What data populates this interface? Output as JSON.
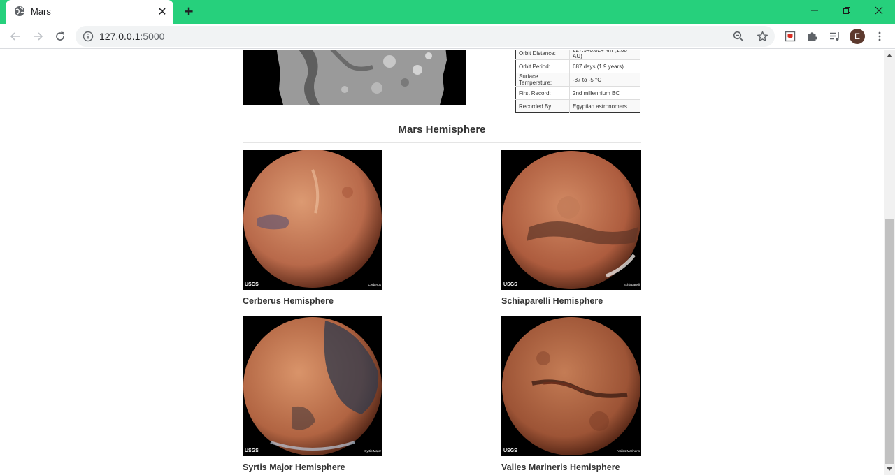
{
  "browser": {
    "tab_title": "Mars",
    "url_host": "127.0.0.1",
    "url_port": ":5000",
    "profile_initial": "E"
  },
  "facts": [
    {
      "label": "Orbit Distance:",
      "value": "227,943,824 km (1.38 AU)"
    },
    {
      "label": "Orbit Period:",
      "value": "687 days (1.9 years)"
    },
    {
      "label": "Surface Temperature:",
      "value": "-87 to -5 °C"
    },
    {
      "label": "First Record:",
      "value": "2nd millennium BC"
    },
    {
      "label": "Recorded By:",
      "value": "Egyptian astronomers"
    }
  ],
  "hemispheres_section": {
    "title": "Mars Hemisphere",
    "items": [
      {
        "name": "Cerberus Hemisphere",
        "caption": "Cerberus"
      },
      {
        "name": "Schiaparelli Hemisphere",
        "caption": "Schiaparelli"
      },
      {
        "name": "Syrtis Major Hemisphere",
        "caption": "Syrtis Major"
      },
      {
        "name": "Valles Marineris Hemisphere",
        "caption": "Valles Marineris"
      }
    ],
    "image_logo": "USGS"
  },
  "colors": {
    "tabstrip": "#26d07c",
    "mars_light": "#d98a5f",
    "mars_dark": "#7a3a22"
  }
}
